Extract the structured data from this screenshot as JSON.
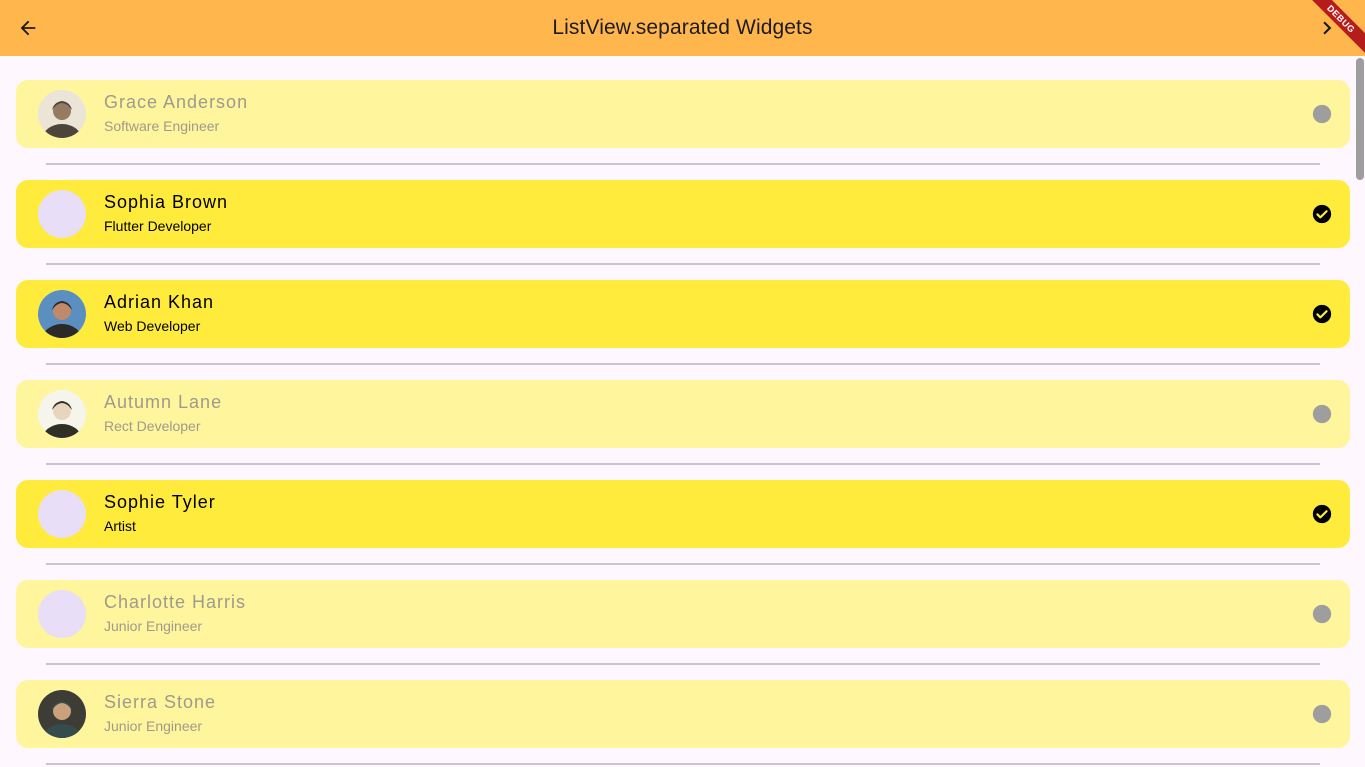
{
  "appbar": {
    "title": "ListView.separated Widgets",
    "debug_label": "DEBUG"
  },
  "items": [
    {
      "name": "Grace Anderson",
      "role": "Software Engineer",
      "selected": false,
      "photo": true,
      "photo_palette": [
        "#3a3230",
        "#8a6e5c",
        "#e9e4df"
      ]
    },
    {
      "name": "Sophia Brown",
      "role": "Flutter Developer",
      "selected": true,
      "photo": false
    },
    {
      "name": "Adrian Khan",
      "role": "Web Developer",
      "selected": true,
      "photo": true,
      "photo_palette": [
        "#2b2a28",
        "#c08a6a",
        "#5a8fc0"
      ]
    },
    {
      "name": "Autumn Lane",
      "role": "Rect Developer",
      "selected": false,
      "photo": true,
      "photo_palette": [
        "#1a1a1a",
        "#e6d2c2",
        "#f5f5f5"
      ]
    },
    {
      "name": "Sophie Tyler",
      "role": "Artist",
      "selected": true,
      "photo": false
    },
    {
      "name": "Charlotte Harris",
      "role": "Junior Engineer",
      "selected": false,
      "photo": false
    },
    {
      "name": "Sierra Stone",
      "role": "Junior Engineer",
      "selected": false,
      "photo": true,
      "photo_palette": [
        "#1f3a44",
        "#c49a7a",
        "#2a2a2a"
      ]
    }
  ],
  "icons": {
    "back": "arrow-left-icon",
    "forward": "chevron-right-icon",
    "selected": "check-circle-icon",
    "unselected": "circle-icon"
  },
  "colors": {
    "appbar": "#ffb74d",
    "tile_selected": "#ffeb3b",
    "tile_unselected": "#fff59d",
    "status_unselected": "#9e9e9e",
    "avatar_placeholder": "#e8def8"
  }
}
